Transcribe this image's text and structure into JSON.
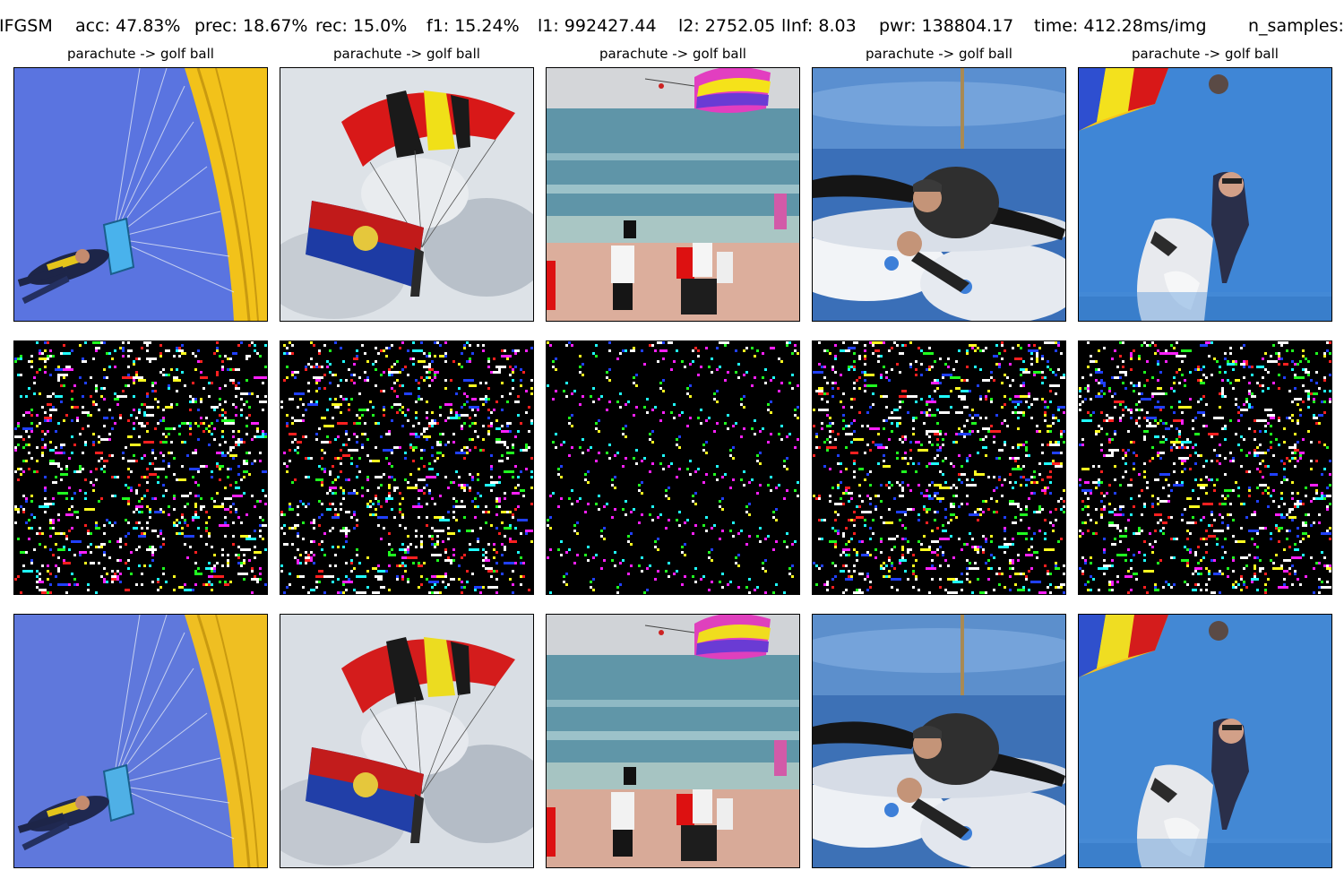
{
  "metrics": {
    "method": "IFGSM",
    "acc": "acc: 47.83%",
    "prec": "prec: 18.67%",
    "rec": "rec: 15.0%",
    "f1": "f1: 15.24%",
    "l1": "l1: 992427.44",
    "l2": "l2: 2752.05",
    "linf": "lInf: 8.03",
    "pwr": "pwr: 138804.17",
    "time": "time: 412.28ms/img",
    "n_samples": "n_samples:"
  },
  "panels": [
    {
      "title": "parachute -> golf ball",
      "scene": "yellow-canopy-skydiver"
    },
    {
      "title": "parachute -> golf ball",
      "scene": "red-canopy-flag"
    },
    {
      "title": "parachute -> golf ball",
      "scene": "beach-crowd-kite"
    },
    {
      "title": "parachute -> golf ball",
      "scene": "tandem-skydivers-clouds"
    },
    {
      "title": "parachute -> golf ball",
      "scene": "shark-parachutist"
    }
  ],
  "rows": [
    "original-image-row",
    "perturbation-row",
    "adversarial-image-row"
  ],
  "colors": {
    "sky_blue": "#5a74e0",
    "canopy_yellow": "#f2c21a",
    "canopy_red": "#d81818",
    "sea": "#5f95a8",
    "sand": "#dcae9c",
    "cloud": "#e3e7ec",
    "noise_bg": "#000000"
  }
}
